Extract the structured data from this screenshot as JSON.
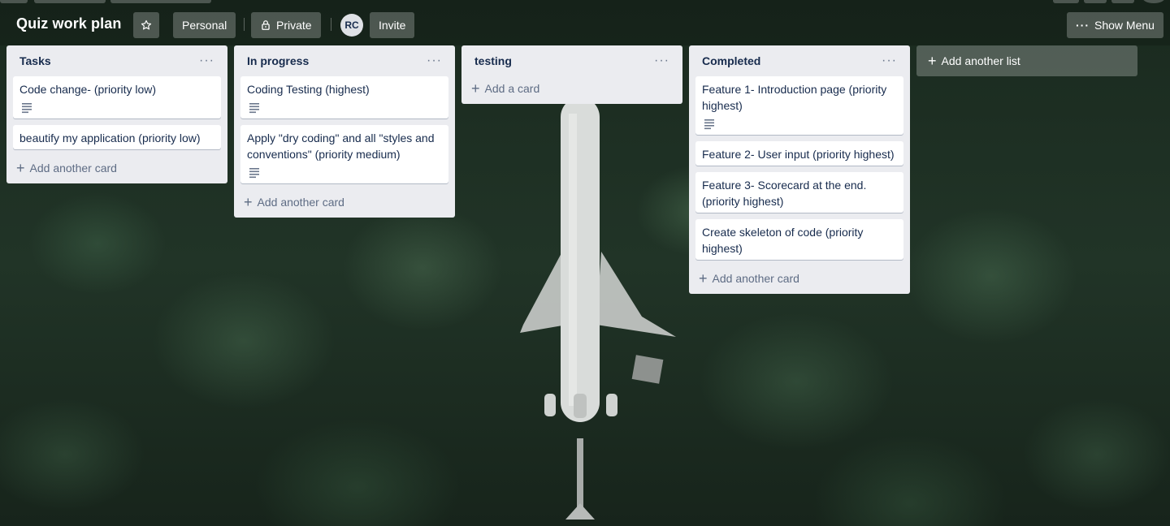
{
  "header": {
    "board_title": "Quiz work plan",
    "star_icon": "star-icon",
    "team_label": "Personal",
    "visibility_label": "Private",
    "visibility_icon": "lock-icon",
    "avatar_initials": "RC",
    "invite_label": "Invite",
    "menu_icon": "ellipsis-icon",
    "menu_label": "Show Menu"
  },
  "lists": [
    {
      "title": "Tasks",
      "cards": [
        {
          "text": "Code change- (priority low)",
          "has_description": true
        },
        {
          "text": "beautify my application (priority low)",
          "has_description": false
        }
      ],
      "add_label": "Add another card"
    },
    {
      "title": "In progress",
      "cards": [
        {
          "text": "Coding Testing (highest)",
          "has_description": true
        },
        {
          "text": "Apply \"dry coding\" and all \"styles and conventions\" (priority medium)",
          "has_description": true
        }
      ],
      "add_label": "Add another card"
    },
    {
      "title": "testing",
      "cards": [],
      "add_label": "Add a card"
    },
    {
      "title": "Completed",
      "cards": [
        {
          "text": "Feature 1- Introduction page (priority highest)",
          "has_description": true
        },
        {
          "text": "Feature 2- User input (priority highest)",
          "has_description": false
        },
        {
          "text": "Feature 3- Scorecard at the end. (priority highest)",
          "has_description": false
        },
        {
          "text": "Create skeleton of code (priority highest)",
          "has_description": false
        }
      ],
      "add_label": "Add another card"
    }
  ],
  "add_list_label": "Add another list",
  "colors": {
    "list_bg": "#ebecf0",
    "card_bg": "#ffffff",
    "text": "#172b4d",
    "muted": "#5e6c84"
  }
}
